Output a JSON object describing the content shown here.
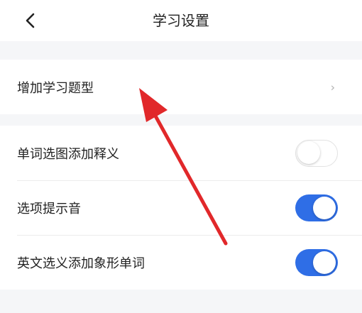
{
  "header": {
    "title": "学习设置",
    "back_icon": "chevron-left-icon"
  },
  "colors": {
    "accent": "#2f6ee6",
    "annotation": "#e1282a"
  },
  "groups": [
    {
      "items": [
        {
          "label": "增加学习题型",
          "control": "chevron",
          "chevron_glyph": "›"
        }
      ]
    },
    {
      "items": [
        {
          "label": "单词选图添加释义",
          "control": "toggle",
          "on": false
        },
        {
          "label": "选项提示音",
          "control": "toggle",
          "on": true
        },
        {
          "label": "英文选义添加象形单词",
          "control": "toggle",
          "on": true
        }
      ]
    }
  ]
}
